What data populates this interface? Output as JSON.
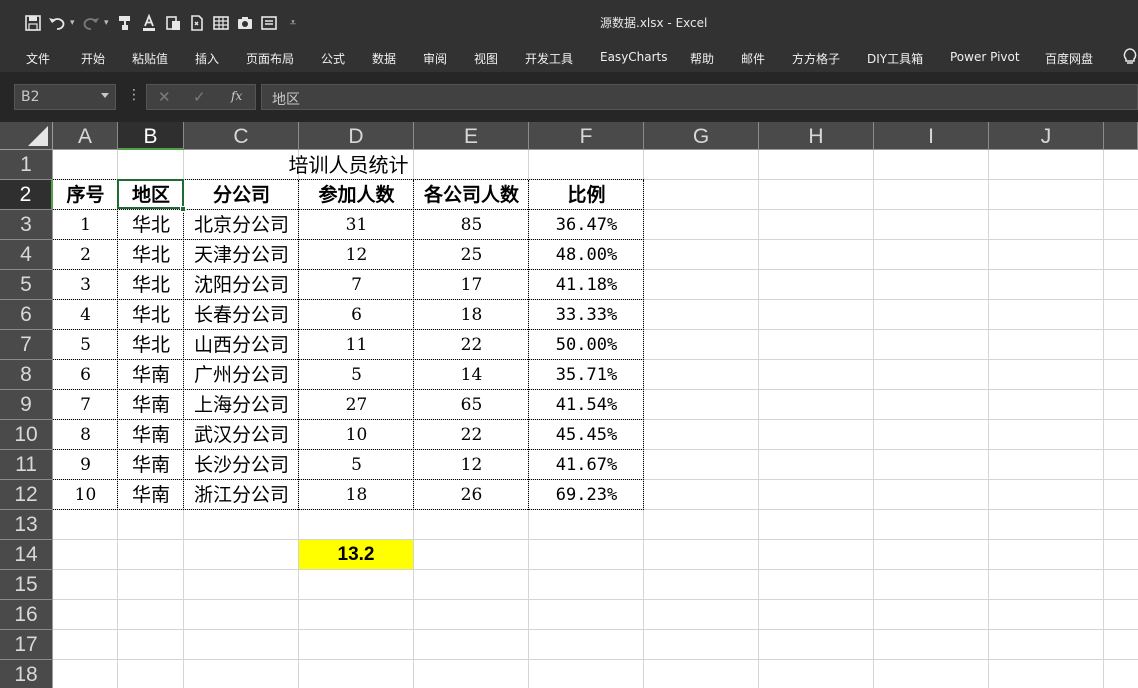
{
  "window": {
    "title": "源数据.xlsx  -  Excel"
  },
  "ribbon": {
    "tabs": [
      "文件",
      "开始",
      "粘贴值",
      "插入",
      "页面布局",
      "公式",
      "数据",
      "审阅",
      "视图",
      "开发工具",
      "EasyCharts",
      "帮助",
      "邮件",
      "方方格子",
      "DIY工具箱",
      "Power Pivot",
      "百度网盘"
    ]
  },
  "formula_bar": {
    "name_box": "B2",
    "fx_label": "fx",
    "content": "地区"
  },
  "columns": [
    "A",
    "B",
    "C",
    "D",
    "E",
    "F",
    "G",
    "H",
    "I",
    "J"
  ],
  "rows": [
    "1",
    "2",
    "3",
    "4",
    "5",
    "6",
    "7",
    "8",
    "9",
    "10",
    "11",
    "12",
    "13",
    "14",
    "15",
    "16",
    "17",
    "18"
  ],
  "selected": {
    "column": "B",
    "row": "2"
  },
  "sheet": {
    "title": "培训人员统计",
    "headers": [
      "序号",
      "地区",
      "分公司",
      "参加人数",
      "各公司人数",
      "比例"
    ],
    "data": [
      [
        "1",
        "华北",
        "北京分公司",
        "31",
        "85",
        "36.47%"
      ],
      [
        "2",
        "华北",
        "天津分公司",
        "12",
        "25",
        "48.00%"
      ],
      [
        "3",
        "华北",
        "沈阳分公司",
        "7",
        "17",
        "41.18%"
      ],
      [
        "4",
        "华北",
        "长春分公司",
        "6",
        "18",
        "33.33%"
      ],
      [
        "5",
        "华北",
        "山西分公司",
        "11",
        "22",
        "50.00%"
      ],
      [
        "6",
        "华南",
        "广州分公司",
        "5",
        "14",
        "35.71%"
      ],
      [
        "7",
        "华南",
        "上海分公司",
        "27",
        "65",
        "41.54%"
      ],
      [
        "8",
        "华南",
        "武汉分公司",
        "10",
        "22",
        "45.45%"
      ],
      [
        "9",
        "华南",
        "长沙分公司",
        "5",
        "12",
        "41.67%"
      ],
      [
        "10",
        "华南",
        "浙江分公司",
        "18",
        "26",
        "69.23%"
      ]
    ],
    "result_value": "13.2"
  },
  "colors": {
    "result_highlight": "#ffff00",
    "selection_accent": "#1f6b34"
  }
}
